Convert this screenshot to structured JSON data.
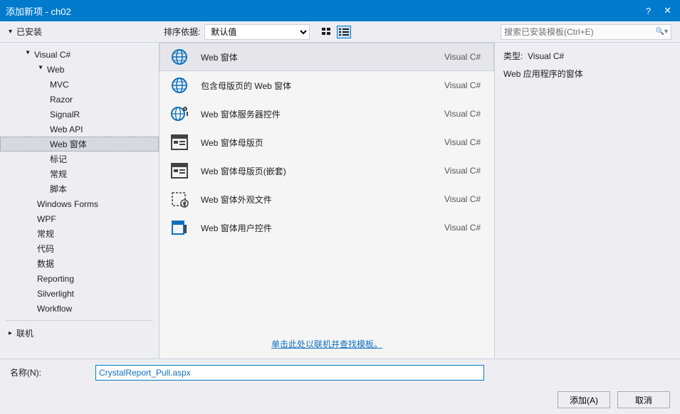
{
  "title": "添加新项 - ch02",
  "help_glyph": "?",
  "close_glyph": "✕",
  "installed_header": "已安装",
  "sort_label": "排序依据:",
  "sort_value": "默认值",
  "search_placeholder": "搜索已安装模板(Ctrl+E)",
  "sidebar": {
    "cs": "Visual C#",
    "web": "Web",
    "items3": [
      "MVC",
      "Razor",
      "SignalR",
      "Web API",
      "Web 窗体",
      "标记",
      "常规",
      "脚本"
    ],
    "selected3_index": 4,
    "items1": [
      "Windows Forms",
      "WPF",
      "常规",
      "代码",
      "数据",
      "Reporting",
      "Silverlight",
      "Workflow"
    ],
    "online": "联机"
  },
  "templates": [
    {
      "label": "Web 窗体",
      "lang": "Visual C#",
      "icon": "globe"
    },
    {
      "label": "包含母版页的 Web 窗体",
      "lang": "Visual C#",
      "icon": "globe"
    },
    {
      "label": "Web 窗体服务器控件",
      "lang": "Visual C#",
      "icon": "globe-gear"
    },
    {
      "label": "Web 窗体母版页",
      "lang": "Visual C#",
      "icon": "master"
    },
    {
      "label": "Web 窗体母版页(嵌套)",
      "lang": "Visual C#",
      "icon": "master"
    },
    {
      "label": "Web 窗体外观文件",
      "lang": "Visual C#",
      "icon": "skin"
    },
    {
      "label": "Web 窗体用户控件",
      "lang": "Visual C#",
      "icon": "userctl"
    }
  ],
  "selected_template_index": 0,
  "online_link": "单击此处以联机并查找模板。",
  "detail": {
    "type_label": "类型:",
    "type_value": "Visual C#",
    "desc": "Web 应用程序的窗体"
  },
  "name_label": "名称(N):",
  "name_value": "CrystalReport_Pull.aspx",
  "add_btn": "添加(A)",
  "cancel_btn": "取消"
}
